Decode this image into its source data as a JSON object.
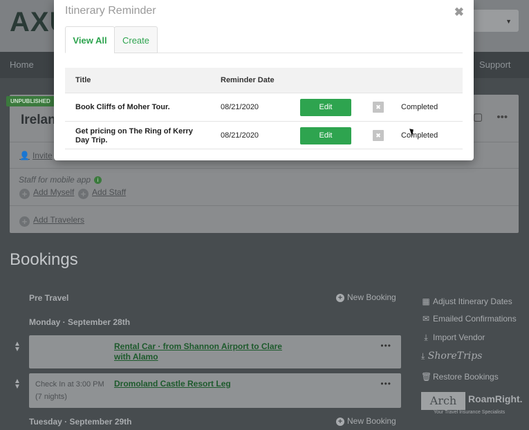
{
  "app": {
    "logo": "AXU"
  },
  "nav": {
    "home": "Home",
    "support": "Support"
  },
  "trip": {
    "badge": "UNPUBLISHED",
    "title": "Irelan",
    "invite": "Invite",
    "staff_label": "Staff for mobile app",
    "add_myself": "Add Myself",
    "add_staff": "Add Staff",
    "add_travelers": "Add Travelers"
  },
  "bookings": {
    "heading": "Bookings",
    "pre_travel": "Pre Travel",
    "new_booking": "New Booking",
    "day1": "Monday · September 28th",
    "day2": "Tuesday · September 29th",
    "items": [
      {
        "title_line1": "Rental Car · from Shannon Airport to Clare",
        "title_line2": "with Alamo"
      },
      {
        "checkin": "Check In at 3:00 PM",
        "nights": "(7 nights)",
        "title_line1": "Dromoland Castle Resort Leg"
      }
    ]
  },
  "sidebar": {
    "adjust": "Adjust Itinerary Dates",
    "emailed": "Emailed Confirmations",
    "import": "Import Vendor",
    "shoretrips": "ShoreTrips",
    "restore": "Restore Bookings",
    "arch": "Arch",
    "roamright": "RoamRight.",
    "arch_tagline": "Your Travel Insurance Specialists"
  },
  "modal": {
    "title": "Itinerary Reminder",
    "close": "✖",
    "tabs": [
      "View All",
      "Create"
    ],
    "columns": {
      "title": "Title",
      "date": "Reminder Date"
    },
    "rows": [
      {
        "title_line1": "Book Cliffs of Moher Tour.",
        "title_line2": "",
        "date": "08/21/2020",
        "edit": "Edit",
        "remove": "✖",
        "status": "Completed"
      },
      {
        "title_line1": "Get pricing on The Ring of Kerry",
        "title_line2": "Day Trip.",
        "date": "08/21/2020",
        "edit": "Edit",
        "remove": "✖",
        "status": "Completed"
      }
    ]
  },
  "colors": {
    "accent": "#2ea44f",
    "overlay": "#474c4f"
  }
}
